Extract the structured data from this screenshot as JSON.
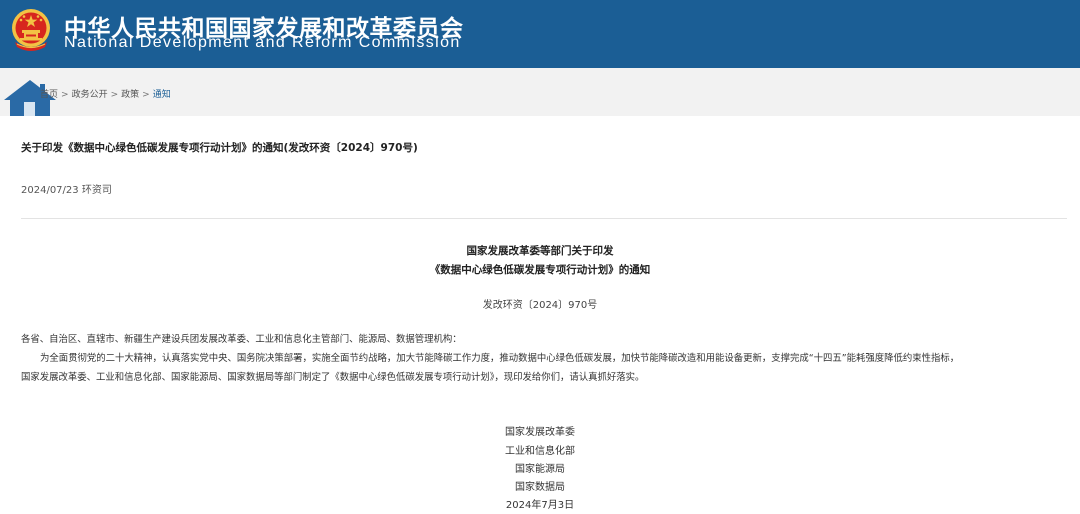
{
  "header": {
    "title_cn": "中华人民共和国国家发展和改革委员会",
    "title_en": "National Development and Reform Commission"
  },
  "breadcrumb": {
    "items": [
      "首页",
      "政务公开",
      "政策",
      "通知"
    ],
    "separator": ">"
  },
  "article": {
    "title": "关于印发《数据中心绿色低碳发展专项行动计划》的通知(发改环资〔2024〕970号)",
    "date": "2024/07/23",
    "source": "环资司"
  },
  "document": {
    "heading_line1": "国家发展改革委等部门关于印发",
    "heading_line2": "《数据中心绿色低碳发展专项行动计划》的通知",
    "doc_number": "发改环资〔2024〕970号",
    "recipients": "各省、自治区、直辖市、新疆生产建设兵团发展改革委、工业和信息化主管部门、能源局、数据管理机构：",
    "body_line1": "为全面贯彻党的二十大精神，认真落实党中央、国务院决策部署，实施全面节约战略，加大节能降碳工作力度，推动数据中心绿色低碳发展，加快节能降碳改造和用能设备更新，支撑完成“十四五”能耗强度降低约束性指标，",
    "body_line2": "国家发展改革委、工业和信息化部、国家能源局、国家数据局等部门制定了《数据中心绿色低碳发展专项行动计划》，现印发给你们，请认真抓好落实。",
    "signatories": [
      "国家发展改革委",
      "工业和信息化部",
      "国家能源局",
      "国家数据局"
    ],
    "sign_date": "2024年7月3日"
  },
  "colors": {
    "header_bg": "#1b5e95",
    "breadcrumb_bg": "#f2f2f2",
    "emblem_red": "#d7261e",
    "emblem_gold": "#f3c244"
  },
  "icons": {
    "emblem": "national-emblem-icon",
    "home": "home-icon"
  }
}
